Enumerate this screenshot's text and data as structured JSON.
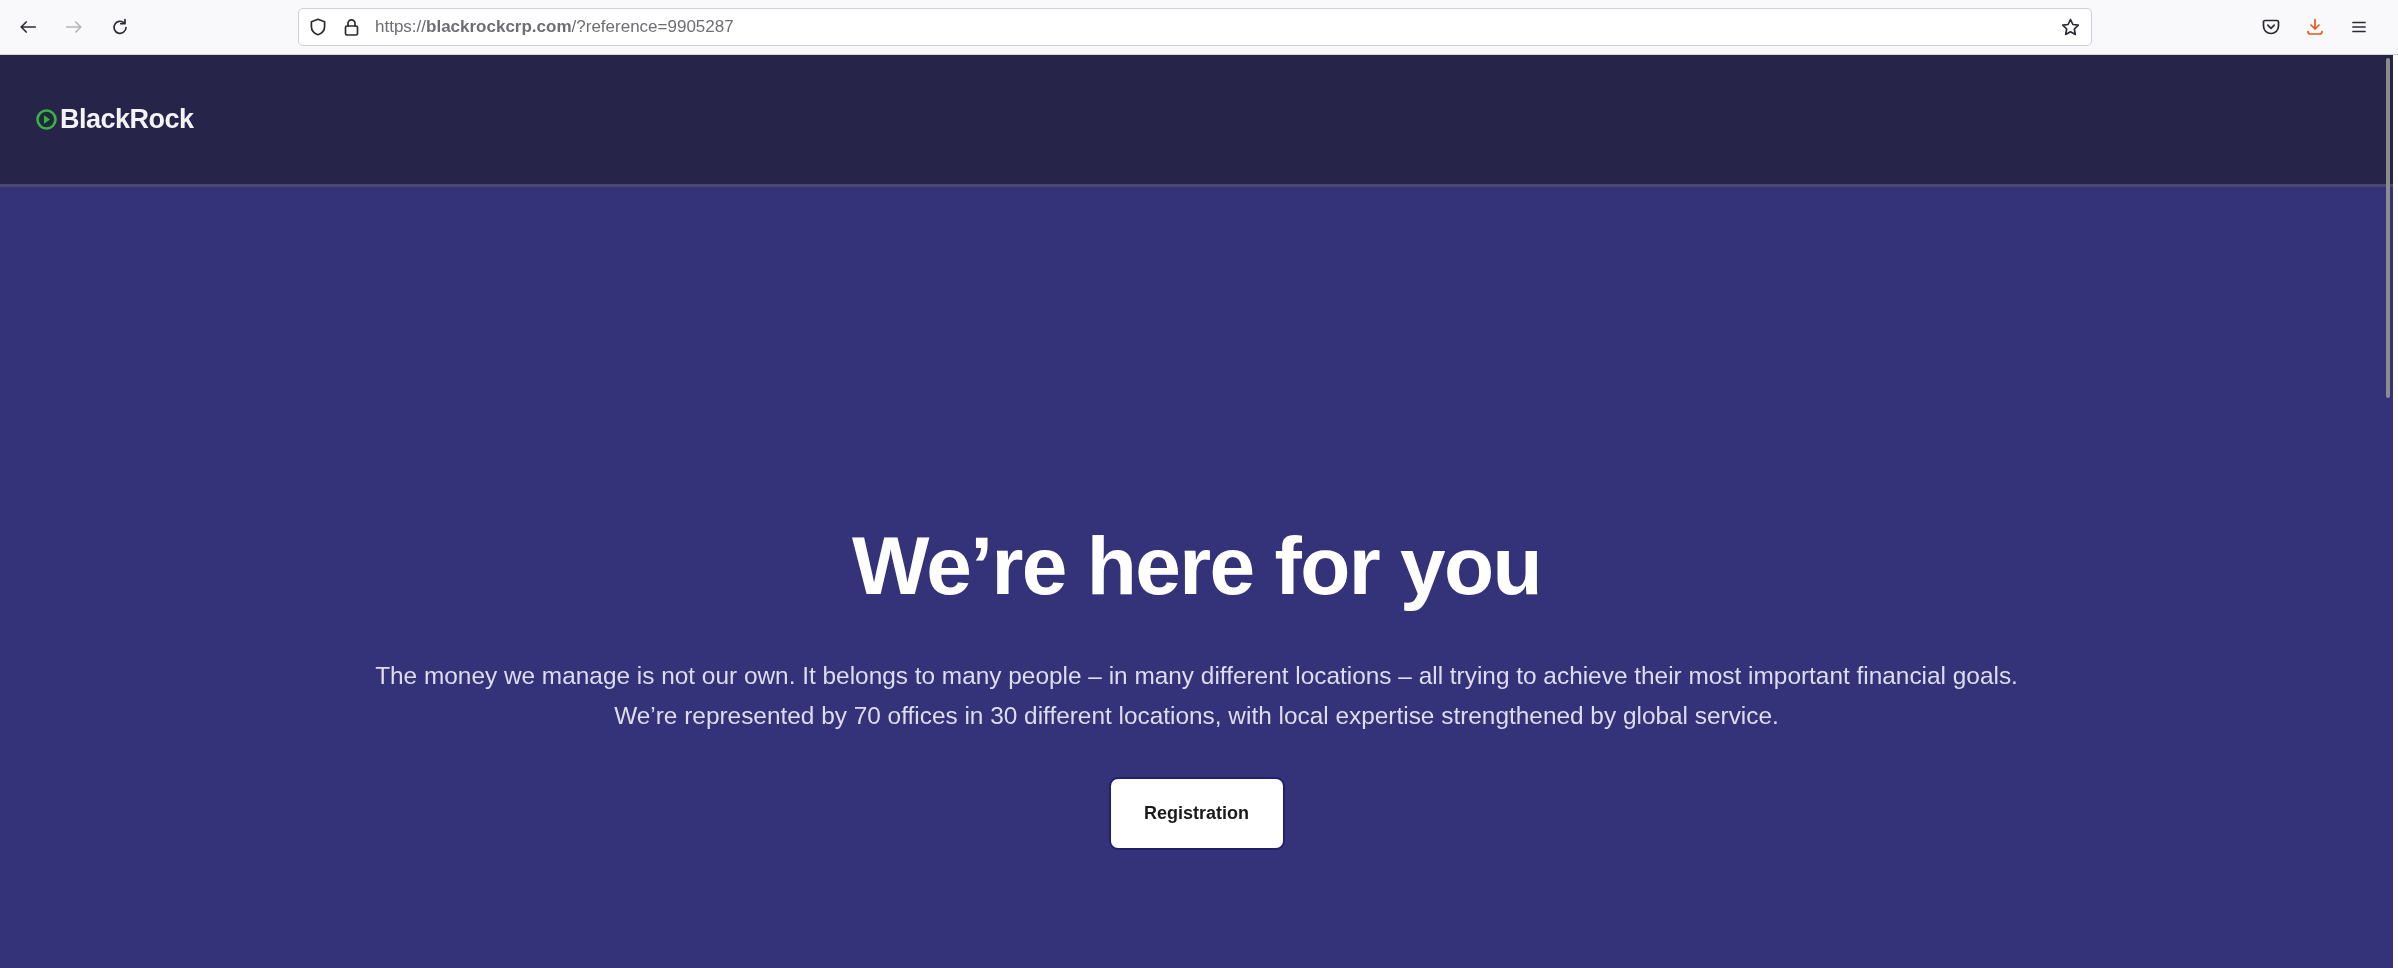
{
  "browser": {
    "nav_buttons": [
      {
        "kind": "back",
        "disabled": false
      },
      {
        "kind": "forward",
        "disabled": true
      },
      {
        "kind": "reload",
        "disabled": false
      }
    ],
    "url": "https://**blackrockcrp.com**/?reference=9905287"
  },
  "header": {
    "logo_text": "BlackRock"
  },
  "hero": {
    "heading": "We’re here for you",
    "lines": [
      "The money we manage is not our own. It belongs to many people – in many different locations – all trying to achieve their most important financial goals.",
      "We’re represented by 70 offices in 30 different locations, with local expertise strengthened by global service."
    ],
    "button": "Registration"
  }
}
